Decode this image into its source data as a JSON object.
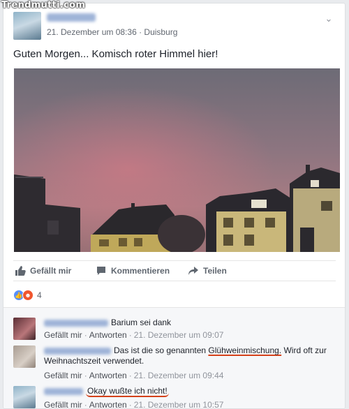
{
  "watermark": "Trendmutti.com",
  "post": {
    "meta": "21. Dezember um 08:36 · Duisburg",
    "text": "Guten Morgen... Komisch roter Himmel hier!"
  },
  "actions": {
    "like": "Gefällt mir",
    "comment": "Kommentieren",
    "share": "Teilen"
  },
  "reactions": {
    "count": "4"
  },
  "comments": [
    {
      "text": "Barium sei dank",
      "like": "Gefällt mir",
      "reply": "Antworten",
      "time": "21. Dezember um 09:07"
    },
    {
      "text_before": "Das ist die so genannten ",
      "highlight": "Glühweinmischung.",
      "text_after": " Wird oft zur Weihnachtszeit verwendet.",
      "like": "Gefällt mir",
      "reply": "Antworten",
      "time": "21. Dezember um 09:44"
    },
    {
      "text": "Okay wußte ich nicht!",
      "like": "Gefällt mir",
      "reply": "Antworten",
      "time": "21. Dezember um 10:57"
    }
  ],
  "colors": {
    "link_blue": "#4267b2",
    "annotation_red": "#d4411a",
    "meta_gray": "#616770"
  }
}
